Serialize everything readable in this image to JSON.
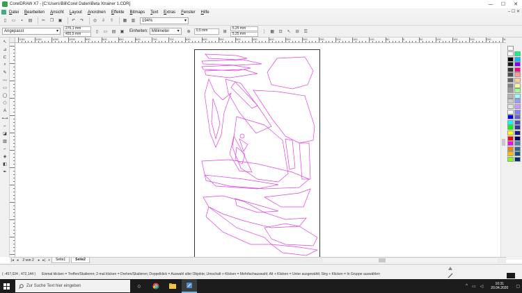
{
  "window": {
    "title": "CorelDRAW X7 - [C:\\Users\\Bill\\Corel Daten\\Beta Xtrainer 1.CDR]",
    "minimize": "—",
    "maximize": "☐",
    "close": "✕"
  },
  "menu": {
    "items": [
      "Datei",
      "Bearbeiten",
      "Ansicht",
      "Layout",
      "Anordnen",
      "Effekte",
      "Bitmaps",
      "Text",
      "Extras",
      "Fenster",
      "Hilfe"
    ],
    "right_controls": "– ☐ ✕"
  },
  "toolbar1": {
    "zoom_value": "194%"
  },
  "toolbar2": {
    "preset": "Angepasst",
    "width": "275,1 mm",
    "height": "455,5 mm",
    "units_label": "Einheiten:",
    "units_value": "Millimeter",
    "nudge": "0,5 mm",
    "dup_x": "5,25 mm",
    "dup_y": "5,25 mm"
  },
  "rulers": {
    "top_labels": [
      "1150",
      "1100",
      "1050",
      "1000",
      "950",
      "900",
      "850",
      "800",
      "750",
      "700",
      "650",
      "600",
      "550",
      "500",
      "450",
      "400",
      "350",
      "300",
      "250",
      "200",
      "150",
      "100",
      "50",
      "0",
      "50",
      "100",
      "150",
      "200",
      "250",
      "300",
      "350",
      "400",
      "450"
    ],
    "units": "Millimeter"
  },
  "document": {
    "pager": "2 von 2",
    "tabs": [
      {
        "label": "Seite1",
        "active": false
      },
      {
        "label": "Seite2",
        "active": true
      }
    ],
    "outline_color": "#e040e0"
  },
  "status": {
    "coords": "( -457,024 ; 472,144 )",
    "hint": "Einmal klicken = Treffen/Skalieren; 2-mal klicken = Drehen/Skalieren; Doppelklick = Auswahl aller Objekte; Umschalt + Klicken = Mehrfachauswahl; Alt + Klicken = Unter ausgewählt; Strg + Klicken = In Gruppe auswählen"
  },
  "palette": {
    "colors": [
      "#ffffff",
      "#000000",
      "#1a1a1a",
      "#333333",
      "#4d4d4d",
      "#666666",
      "#808080",
      "#999999",
      "#b3b3b3",
      "#cccccc",
      "#e6e6e6",
      "#ffffff",
      "#0000ff",
      "#00ffff",
      "#00ff00",
      "#ffff00",
      "#ff0000",
      "#ff00ff",
      "#ff8000",
      "#ffbf00",
      "#80ff00",
      "#00ff80",
      "#00bfff",
      "#8000ff",
      "#ff0080",
      "#ff9999",
      "#ffcc99",
      "#ffff99",
      "#99ff99",
      "#99ffff",
      "#9999ff",
      "#cc99ff",
      "#8080ff",
      "#6666cc",
      "#4d4db3",
      "#333399",
      "#1a1a80",
      "#000066",
      "#4d80b3",
      "#336699",
      "#1a4d80",
      "#003366"
    ]
  },
  "taskbar": {
    "search_placeholder": "Zur Suche Text hier eingeben",
    "time": "10:31",
    "date": "20.04.2020"
  }
}
